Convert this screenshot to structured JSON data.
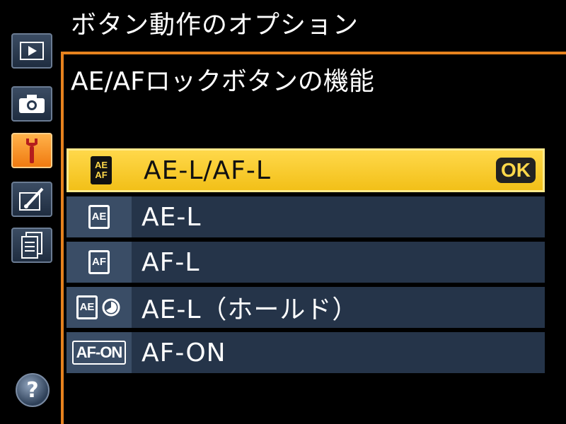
{
  "header": {
    "menu_title": "ボタン動作のオプション",
    "sub_title": "AE/AFロックボタンの機能"
  },
  "sidebar": {
    "items": [
      {
        "name": "playback-menu",
        "icon": "play-icon",
        "active": false
      },
      {
        "name": "shooting-menu",
        "icon": "camera-icon",
        "active": false
      },
      {
        "name": "custom-settings-menu",
        "icon": "wrench-icon",
        "active": true
      },
      {
        "name": "retouch-menu",
        "icon": "brush-icon",
        "active": false
      },
      {
        "name": "my-menu",
        "icon": "list-icon",
        "active": false
      }
    ],
    "help_label": "?"
  },
  "options": [
    {
      "label": "AE-L/AF-L",
      "icon_text": [
        "AE",
        "AF"
      ],
      "selected": true,
      "ok_label": "OK"
    },
    {
      "label": "AE-L",
      "icon_text": [
        "AE"
      ],
      "selected": false
    },
    {
      "label": "AF-L",
      "icon_text": [
        "AF"
      ],
      "selected": false
    },
    {
      "label": "AE-L（ホールド）",
      "icon_text": [
        "AE"
      ],
      "selected": false
    },
    {
      "label": "AF-ON",
      "icon_text": [
        "AF-ON"
      ],
      "selected": false
    }
  ],
  "colors": {
    "accent_orange": "#e6821e",
    "selected_yellow": "#f2c018",
    "row_background": "#253449"
  }
}
